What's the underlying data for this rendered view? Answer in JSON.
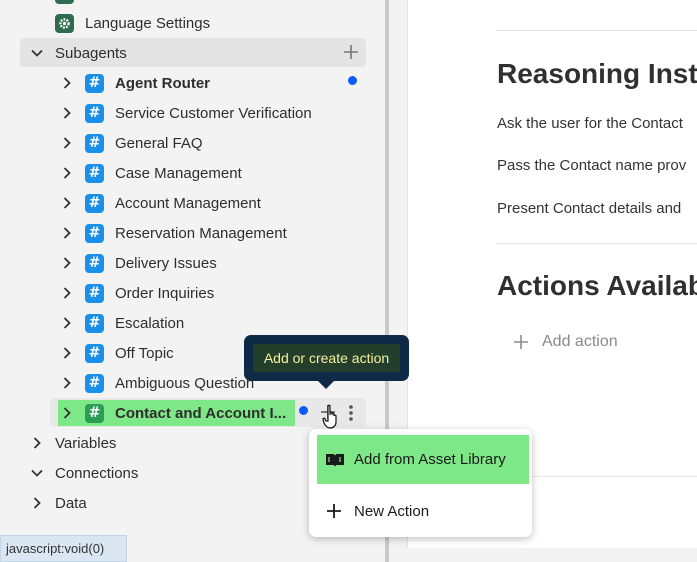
{
  "sidebar": {
    "language_settings": "Language Settings",
    "subagents_label": "Subagents",
    "items": [
      {
        "label": "Agent Router"
      },
      {
        "label": "Service Customer Verification"
      },
      {
        "label": "General FAQ"
      },
      {
        "label": "Case Management"
      },
      {
        "label": "Account Management"
      },
      {
        "label": "Reservation Management"
      },
      {
        "label": "Delivery Issues"
      },
      {
        "label": "Order Inquiries"
      },
      {
        "label": "Escalation"
      },
      {
        "label": "Off Topic"
      },
      {
        "label": "Ambiguous Question"
      },
      {
        "label": "Contact and Account I..."
      }
    ],
    "variables_label": "Variables",
    "connections_label": "Connections",
    "data_label": "Data"
  },
  "tooltip": {
    "text": "Add or create action"
  },
  "action_menu": {
    "add_from_library": "Add from Asset Library",
    "new_action": "New Action"
  },
  "main": {
    "reasoning_heading": "Reasoning Inst",
    "lines": [
      "Ask the user for the Contact",
      "Pass the Contact name prov",
      "Present Contact details and"
    ],
    "actions_heading": "Actions Availab",
    "add_action": "Add action"
  },
  "status_bar": {
    "text": "javascript:void(0)"
  },
  "colors": {
    "hash_blue": "#1b8fea",
    "highlight_green": "#7ee787",
    "dot_blue": "#0b5cff",
    "tooltip_bg": "#0e2a47"
  }
}
